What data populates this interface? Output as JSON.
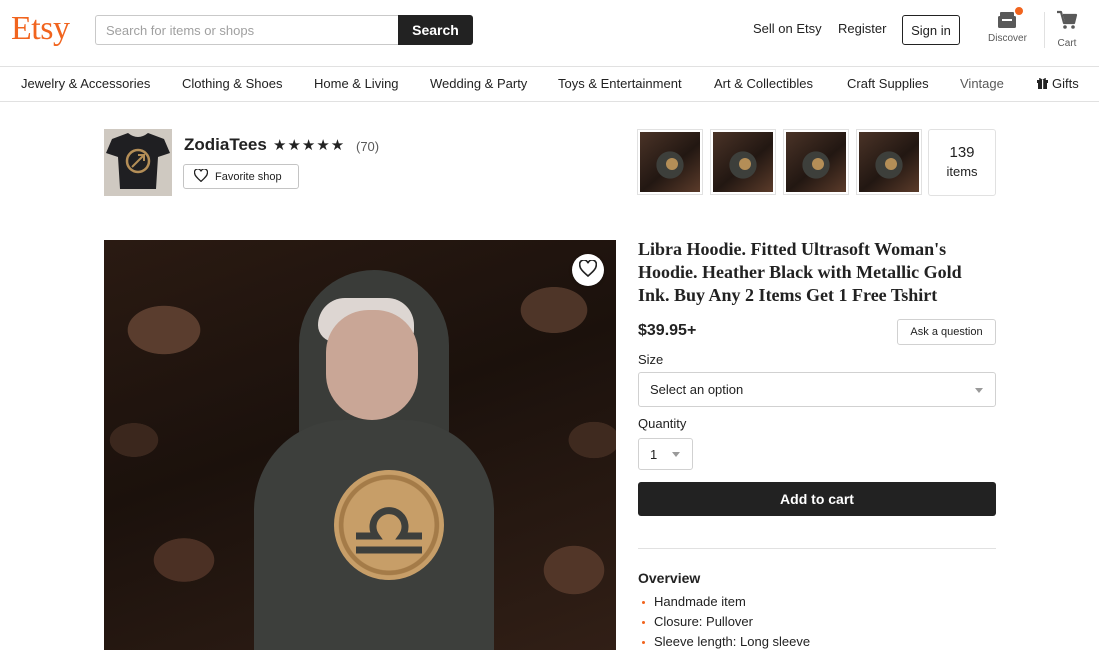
{
  "header": {
    "logo": "Etsy",
    "search_placeholder": "Search for items or shops",
    "search_button": "Search",
    "sell_link": "Sell on Etsy",
    "register_link": "Register",
    "signin_button": "Sign in",
    "discover_label": "Discover",
    "cart_label": "Cart"
  },
  "categories": [
    "Jewelry & Accessories",
    "Clothing & Shoes",
    "Home & Living",
    "Wedding & Party",
    "Toys & Entertainment",
    "Art & Collectibles",
    "Craft Supplies",
    "Vintage",
    "Gifts"
  ],
  "shop": {
    "name": "ZodiaTees",
    "stars": "★★★★★",
    "review_count": "(70)",
    "favorite_button": "Favorite shop",
    "items_count": "139",
    "items_label": "items"
  },
  "listing": {
    "title": "Libra Hoodie. Fitted Ultrasoft Woman's Hoodie. Heather Black with Metallic Gold Ink. Buy Any 2 Items Get 1 Free Tshirt",
    "price": "$39.95+",
    "ask_button": "Ask a question",
    "size_label": "Size",
    "size_value": "Select an option",
    "quantity_label": "Quantity",
    "quantity_value": "1",
    "add_to_cart": "Add to cart",
    "overview_heading": "Overview",
    "overview_items": [
      "Handmade item",
      "Closure: Pullover",
      "Sleeve length: Long sleeve"
    ]
  },
  "colors": {
    "brand": "#f1641e",
    "primary_button": "#222222"
  }
}
